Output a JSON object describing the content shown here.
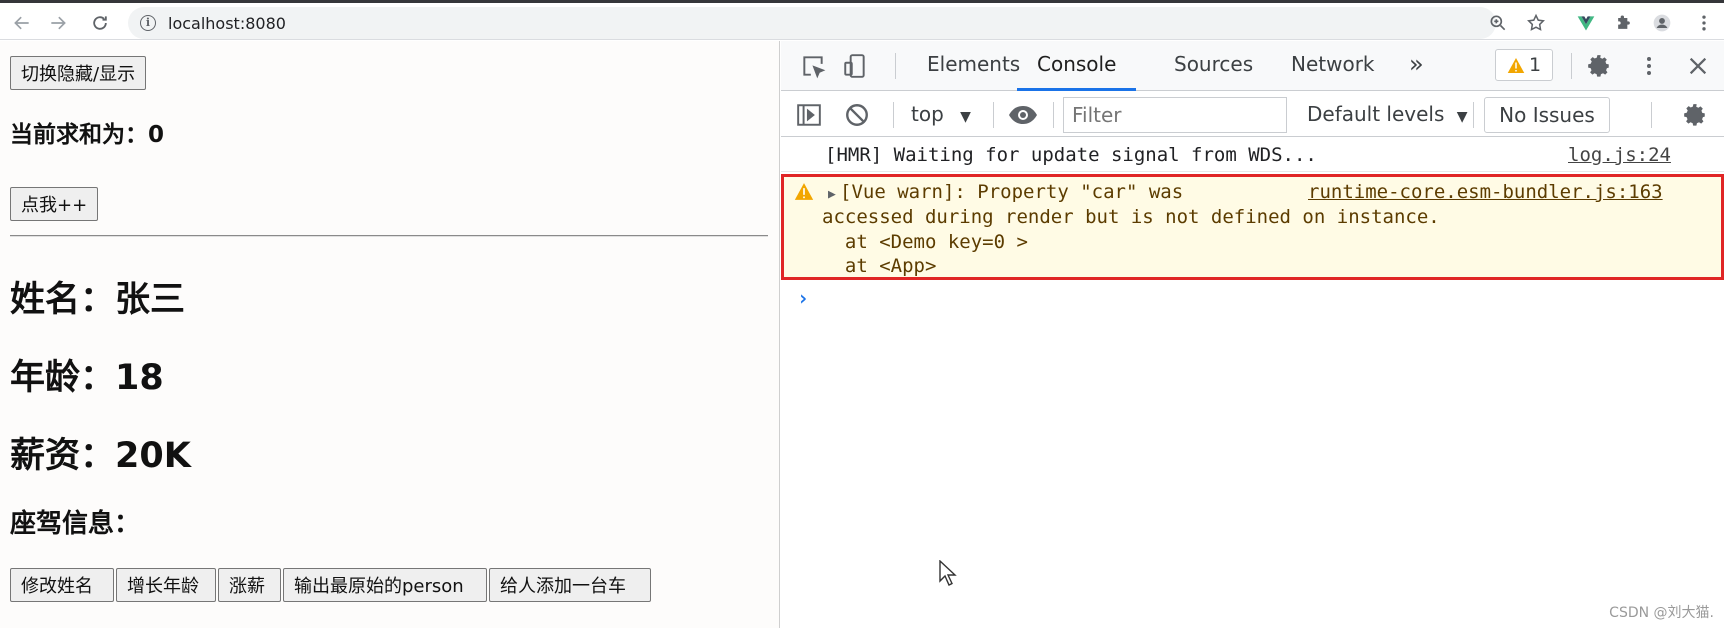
{
  "browser": {
    "url": "localhost:8080"
  },
  "page": {
    "toggle_button": "切换隐藏/显示",
    "sum_text": "当前求和为：0",
    "click_button": "点我++",
    "name_text": "姓名：张三",
    "age_text": "年龄：18",
    "salary_text": "薪资：20K",
    "car_info_text": "座驾信息：",
    "actions": [
      "修改姓名",
      "增长年龄",
      "涨薪",
      "输出最原始的person",
      "给人添加一台车"
    ]
  },
  "devtools": {
    "tabs": [
      "Elements",
      "Console",
      "Sources",
      "Network"
    ],
    "more_tabs": "»",
    "active_tab": "Console",
    "warning_count": "1",
    "context": "top",
    "filter_placeholder": "Filter",
    "levels": "Default levels",
    "issues": "No Issues",
    "logs": {
      "hmr_message": "[HMR] Waiting for update signal from WDS...",
      "hmr_source": "log.js:24",
      "warn_line1": "[Vue warn]: Property \"car\" was",
      "warn_source": "runtime-core.esm-bundler.js:163",
      "warn_line2": "accessed during render but is not defined on instance.",
      "warn_line3": "  at <Demo key=0 >",
      "warn_line4": "  at <App>"
    },
    "prompt_symbol": "›"
  },
  "watermark": "CSDN @刘大猫.",
  "colors": {
    "accent": "#1a73e8",
    "warning_bg": "#fffbe5",
    "highlight_border": "#e02525",
    "vue_green": "#41b883"
  }
}
